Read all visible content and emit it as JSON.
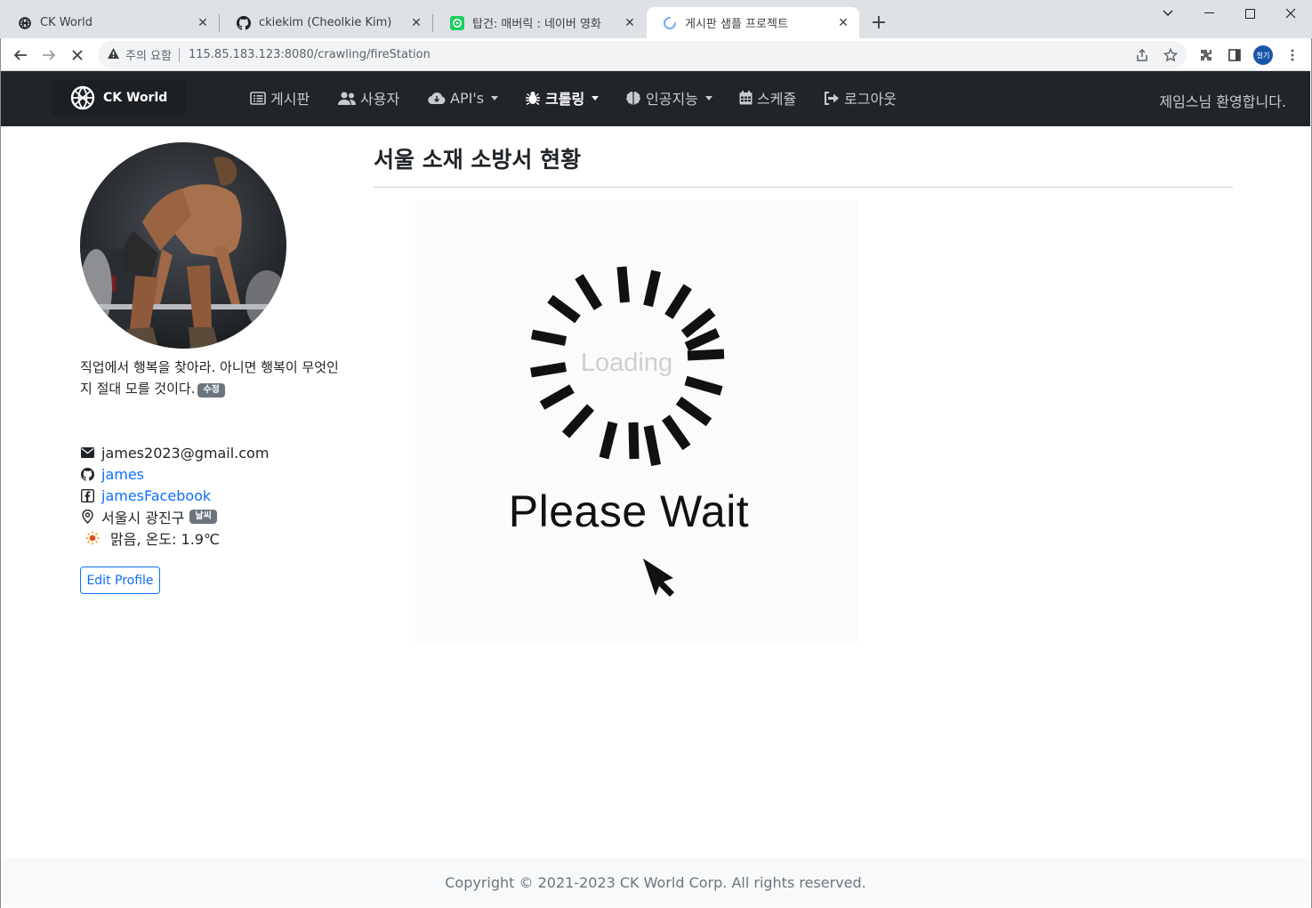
{
  "browser": {
    "tabs": [
      {
        "title": "CK World",
        "icon": "globe-icon"
      },
      {
        "title": "ckiekim (Cheolkie Kim)",
        "icon": "github-icon"
      },
      {
        "title": "탑건: 매버릭 : 네이버 영화",
        "icon": "naver-movie-icon"
      },
      {
        "title": "게시판 샘플 프로젝트",
        "icon": "loading-spinner-icon"
      }
    ],
    "security_warning": "주의 요함",
    "url": "115.85.183.123:8080/crawling/fireStation",
    "profile_initials": "철기"
  },
  "navbar": {
    "brand": "CK World",
    "items": [
      {
        "label": "게시판",
        "icon": "list-icon",
        "dropdown": false
      },
      {
        "label": "사용자",
        "icon": "users-icon",
        "dropdown": false
      },
      {
        "label": "API's",
        "icon": "cloud-icon",
        "dropdown": true
      },
      {
        "label": "크롤링",
        "icon": "bug-icon",
        "dropdown": true,
        "active": true
      },
      {
        "label": "인공지능",
        "icon": "brain-icon",
        "dropdown": true
      },
      {
        "label": "스케쥴",
        "icon": "calendar-icon",
        "dropdown": false
      },
      {
        "label": "로그아웃",
        "icon": "logout-icon",
        "dropdown": false
      }
    ],
    "welcome": "제임스님 환영합니다."
  },
  "profile": {
    "motto": "직업에서 행복을 찾아라. 아니면 행복이 무엇인지 절대 모를 것이다.",
    "motto_badge": "수정",
    "email": "james2023@gmail.com",
    "github": "james",
    "facebook": "jamesFacebook",
    "location": "서울시 광진구",
    "weather_badge": "날씨",
    "weather": "맑음, 온도: 1.9℃",
    "edit_button": "Edit Profile"
  },
  "main": {
    "title": "서울 소재 소방서 현황",
    "loading_text": "Loading",
    "wait_text": "Please Wait"
  },
  "footer": {
    "copyright": "Copyright © 2021-2023 CK World Corp. All rights reserved."
  },
  "colors": {
    "navbar_bg": "#212529",
    "link": "#0d6efd",
    "badge": "#6c757d",
    "footer_bg": "#f8f9fa"
  }
}
